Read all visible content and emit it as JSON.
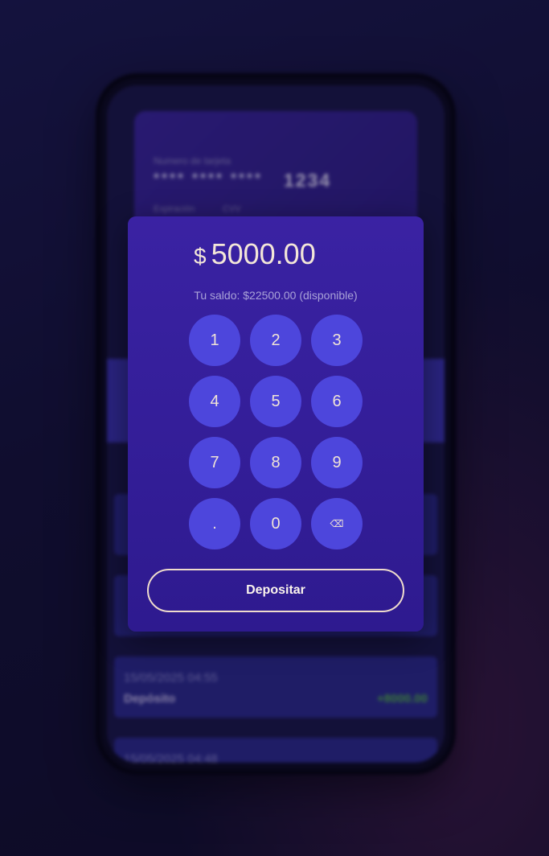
{
  "background": {
    "card": {
      "number_label": "Numero de tarjeta",
      "number_masked": "**** **** ****",
      "last4": "1234",
      "expiration_label": "Expiración",
      "cvv_label": "CVV"
    },
    "transactions": [
      {
        "date": "",
        "type": "",
        "amount": ""
      },
      {
        "date": "",
        "type": "",
        "amount": ""
      },
      {
        "date": "15/05/2025 04:55",
        "type": "Depósito",
        "amount": "+8000.00"
      },
      {
        "date": "15/05/2025 04:48",
        "type": "",
        "amount": ""
      }
    ]
  },
  "modal": {
    "currency_symbol": "$",
    "amount": "5000.00",
    "balance_text": "Tu saldo: $22500.00 (disponible)",
    "keys": [
      "1",
      "2",
      "3",
      "4",
      "5",
      "6",
      "7",
      "8",
      "9",
      ".",
      "0",
      "⌫"
    ],
    "deposit_label": "Depositar"
  },
  "colors": {
    "modal_bg": "#3a22a3",
    "key_bg": "#4d46dc",
    "amount_text": "#f3e6d8",
    "positive_amount": "#56b84a",
    "negative_amount": "#d0243a"
  }
}
